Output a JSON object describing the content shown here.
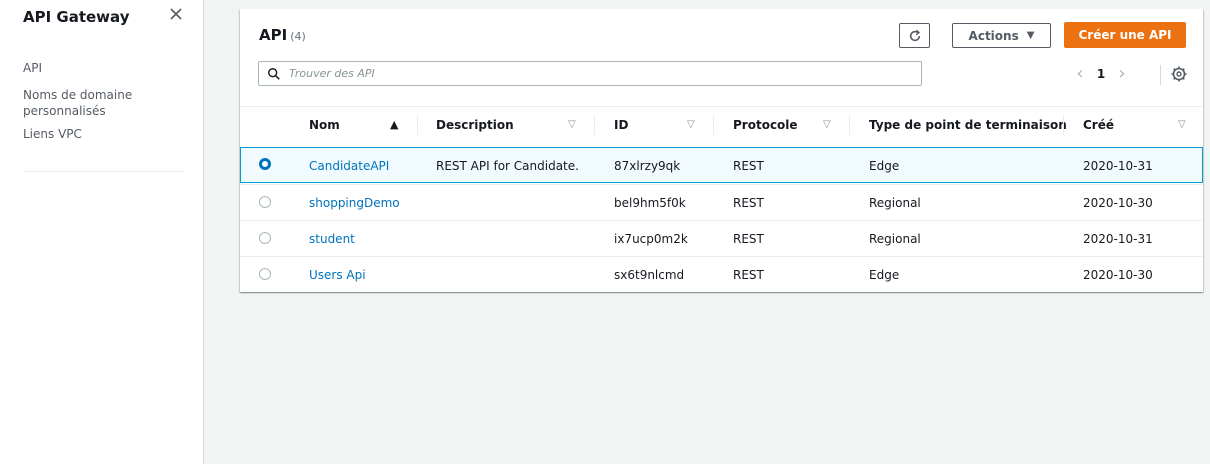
{
  "sidebar": {
    "title": "API Gateway",
    "items": [
      {
        "label": "API"
      },
      {
        "label": "Noms de domaine personnalisés"
      },
      {
        "label": "Liens VPC"
      }
    ]
  },
  "panel": {
    "title": "API",
    "count": "(4)",
    "refresh_icon": "refresh-icon",
    "actions_label": "Actions",
    "create_label": "Créer une API",
    "search_placeholder": "Trouver des API",
    "page_number": "1",
    "settings_icon": "gear-icon"
  },
  "table": {
    "columns": [
      "Nom",
      "Description",
      "ID",
      "Protocole",
      "Type de point de terminaison",
      "Créé"
    ],
    "sort_column": "Nom",
    "rows": [
      {
        "selected": true,
        "name": "CandidateAPI",
        "description": "REST API for Candidate.",
        "id": "87xlrzy9qk",
        "protocol": "REST",
        "endpoint_type": "Edge",
        "created": "2020-10-31"
      },
      {
        "selected": false,
        "name": "shoppingDemo",
        "description": "",
        "id": "bel9hm5f0k",
        "protocol": "REST",
        "endpoint_type": "Regional",
        "created": "2020-10-30"
      },
      {
        "selected": false,
        "name": "student",
        "description": "",
        "id": "ix7ucp0m2k",
        "protocol": "REST",
        "endpoint_type": "Regional",
        "created": "2020-10-31"
      },
      {
        "selected": false,
        "name": "Users Api",
        "description": "",
        "id": "sx6t9nlcmd",
        "protocol": "REST",
        "endpoint_type": "Edge",
        "created": "2020-10-30"
      }
    ]
  },
  "colors": {
    "primary_button": "#ec7211",
    "link": "#0073bb",
    "selected_border": "#00a1c9",
    "selected_bg": "#f1faff"
  }
}
